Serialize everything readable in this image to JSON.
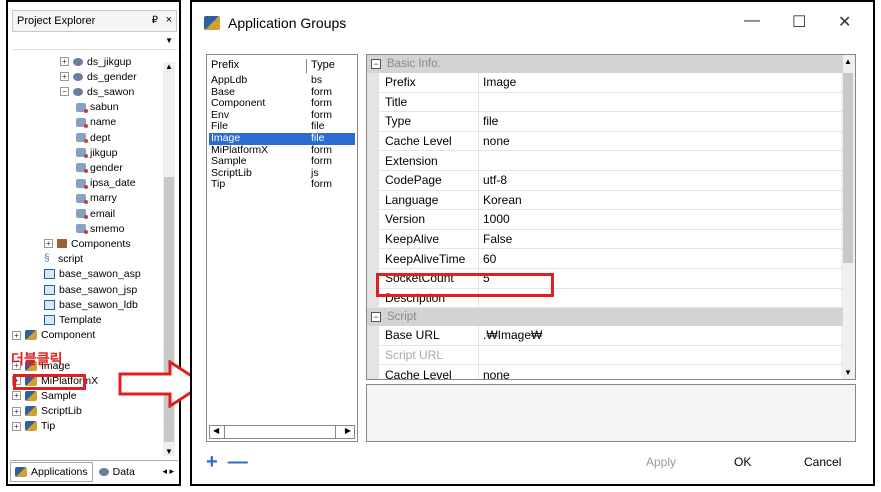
{
  "explorer": {
    "title": "Project Explorer",
    "pin": "₽",
    "close": "×",
    "tree": [
      {
        "label": "ds_jikgup",
        "kind": "db",
        "expander": "⊞",
        "indent": 3
      },
      {
        "label": "ds_gender",
        "kind": "db",
        "expander": "⊞",
        "indent": 3
      },
      {
        "label": "ds_sawon",
        "kind": "db",
        "expander": "⊟",
        "indent": 3
      },
      {
        "label": "sabun",
        "kind": "field",
        "indent": 4
      },
      {
        "label": "name",
        "kind": "field",
        "indent": 4
      },
      {
        "label": "dept",
        "kind": "field",
        "indent": 4
      },
      {
        "label": "jikgup",
        "kind": "field",
        "indent": 4
      },
      {
        "label": "gender",
        "kind": "field",
        "indent": 4
      },
      {
        "label": "ipsa_date",
        "kind": "field",
        "indent": 4
      },
      {
        "label": "marry",
        "kind": "field",
        "indent": 4
      },
      {
        "label": "email",
        "kind": "field",
        "indent": 4
      },
      {
        "label": "smemo",
        "kind": "field",
        "indent": 4
      },
      {
        "label": "Components",
        "kind": "comp",
        "expander": "⊞",
        "indent": 2
      },
      {
        "label": "script",
        "kind": "script",
        "indent": 2
      },
      {
        "label": "base_sawon_asp",
        "kind": "form",
        "indent": 2
      },
      {
        "label": "base_sawon_jsp",
        "kind": "form",
        "indent": 2
      },
      {
        "label": "base_sawon_ldb",
        "kind": "form",
        "indent": 2
      },
      {
        "label": "Template",
        "kind": "form",
        "indent": 2
      },
      {
        "label": "Component",
        "kind": "group",
        "expander": "⊞",
        "indent": 0
      },
      {
        "label": "",
        "kind": "blank",
        "indent": 0
      },
      {
        "label": "Image",
        "kind": "group",
        "expander": "⊞",
        "indent": 0
      },
      {
        "label": "MiPlatformX",
        "kind": "group",
        "expander": "⊞",
        "indent": 0
      },
      {
        "label": "Sample",
        "kind": "group",
        "expander": "⊞",
        "indent": 0
      },
      {
        "label": "ScriptLib",
        "kind": "group",
        "expander": "⊞",
        "indent": 0
      },
      {
        "label": "Tip",
        "kind": "group",
        "expander": "⊞",
        "indent": 0
      }
    ],
    "annotation": "더블클릭",
    "tabs": {
      "applications": "Applications",
      "data": "Data",
      "arrows": "◂ ▸"
    }
  },
  "dialog": {
    "title": "Application Groups",
    "minimize": "—",
    "maximize": "☐",
    "close": "✕",
    "list_headers": {
      "prefix": "Prefix",
      "type": "Type"
    },
    "list_rows": [
      {
        "prefix": "AppLdb",
        "type": "bs"
      },
      {
        "prefix": "Base",
        "type": "form"
      },
      {
        "prefix": "Component",
        "type": "form"
      },
      {
        "prefix": "Env",
        "type": "form"
      },
      {
        "prefix": "File",
        "type": "file"
      },
      {
        "prefix": "Image",
        "type": "file",
        "selected": true
      },
      {
        "prefix": "MiPlatformX",
        "type": "form"
      },
      {
        "prefix": "Sample",
        "type": "form"
      },
      {
        "prefix": "ScriptLib",
        "type": "js"
      },
      {
        "prefix": "Tip",
        "type": "form"
      }
    ],
    "sections": {
      "basic": "Basic Info.",
      "script": "Script"
    },
    "basic_props": [
      {
        "key": "Prefix",
        "value": "Image"
      },
      {
        "key": "Title",
        "value": ""
      },
      {
        "key": "Type",
        "value": "file"
      },
      {
        "key": "Cache Level",
        "value": "none"
      },
      {
        "key": "Extension",
        "value": ""
      },
      {
        "key": "CodePage",
        "value": "utf-8"
      },
      {
        "key": "Language",
        "value": "Korean"
      },
      {
        "key": "Version",
        "value": "1000"
      },
      {
        "key": "KeepAlive",
        "value": "False"
      },
      {
        "key": "KeepAliveTime",
        "value": "60"
      },
      {
        "key": "SocketCount",
        "value": "5"
      },
      {
        "key": "Description",
        "value": ""
      }
    ],
    "script_props": [
      {
        "key": "Base URL",
        "value": ".₩Image₩"
      },
      {
        "key": "Script URL",
        "value": "",
        "dim": true
      },
      {
        "key": "Cache Level",
        "value": "none"
      }
    ],
    "buttons": {
      "add": "+",
      "remove": "—",
      "apply": "Apply",
      "ok": "OK",
      "cancel": "Cancel"
    },
    "colors": {
      "selection": "#2a6cd0",
      "highlight": "#e02020"
    }
  }
}
